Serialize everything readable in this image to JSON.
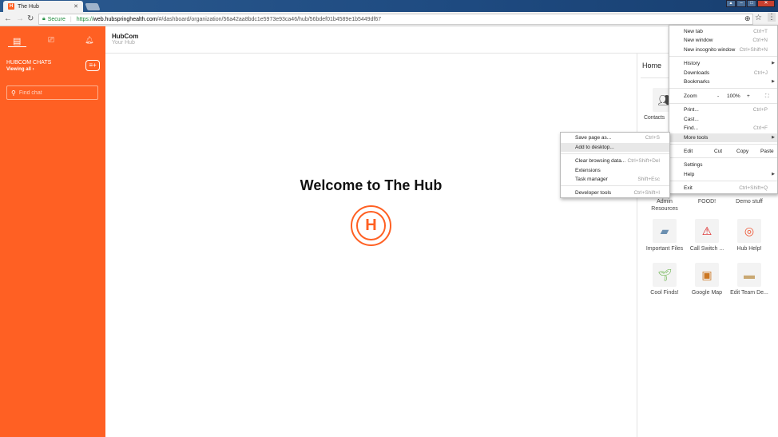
{
  "browser": {
    "tab_title": "The Hub",
    "tab_favicon": "H",
    "secure_label": "Secure",
    "url_scheme": "https://",
    "url_host": "web.hubspringhealth.com",
    "url_path": "/#/dashboard/organization/56a42aa8bdc1e5973e93ca46/hub/56bdef01b4589e1b5449df67"
  },
  "sidebar": {
    "section_title": "HUBCOM CHATS",
    "viewing": "Viewing all ›",
    "search_placeholder": "Find chat",
    "accent": "#ff6023"
  },
  "header": {
    "title": "HubCom",
    "subtitle": "Your Hub"
  },
  "main": {
    "welcome": "Welcome to The Hub",
    "logo_letter": "H"
  },
  "home_panel": {
    "title": "Home",
    "tiles": [
      {
        "label": "Contacts",
        "shown": "Conta"
      },
      {
        "label": "Admin Resources"
      },
      {
        "label": "FOOD!"
      },
      {
        "label": "Demo stuff"
      },
      {
        "label": "Important Files"
      },
      {
        "label": "Call Switch ..."
      },
      {
        "label": "Hub Help!"
      },
      {
        "label": "Cool Finds!"
      },
      {
        "label": "Google Map"
      },
      {
        "label": "Edit Team De..."
      }
    ]
  },
  "chrome_menu": {
    "items": [
      {
        "label": "New tab",
        "shortcut": "Ctrl+T"
      },
      {
        "label": "New window",
        "shortcut": "Ctrl+N"
      },
      {
        "label": "New incognito window",
        "shortcut": "Ctrl+Shift+N"
      },
      {
        "label": "History",
        "shortcut": ""
      },
      {
        "label": "Downloads",
        "shortcut": "Ctrl+J"
      },
      {
        "label": "Bookmarks",
        "shortcut": ""
      },
      {
        "label": "Print...",
        "shortcut": "Ctrl+P"
      },
      {
        "label": "Cast...",
        "shortcut": ""
      },
      {
        "label": "Find...",
        "shortcut": "Ctrl+F"
      },
      {
        "label": "More tools",
        "shortcut": ""
      },
      {
        "label": "Settings",
        "shortcut": ""
      },
      {
        "label": "Help",
        "shortcut": ""
      },
      {
        "label": "Exit",
        "shortcut": "Ctrl+Shift+Q"
      }
    ],
    "zoom": {
      "label": "Zoom",
      "minus": "-",
      "value": "100%",
      "plus": "+"
    },
    "edit": {
      "label": "Edit",
      "cut": "Cut",
      "copy": "Copy",
      "paste": "Paste"
    }
  },
  "more_tools_menu": {
    "items": [
      {
        "label": "Save page as...",
        "shortcut": "Ctrl+S"
      },
      {
        "label": "Add to desktop...",
        "shortcut": ""
      },
      {
        "label": "Clear browsing data...",
        "shortcut": "Ctrl+Shift+Del"
      },
      {
        "label": "Extensions",
        "shortcut": ""
      },
      {
        "label": "Task manager",
        "shortcut": "Shift+Esc"
      },
      {
        "label": "Developer tools",
        "shortcut": "Ctrl+Shift+I"
      }
    ]
  }
}
